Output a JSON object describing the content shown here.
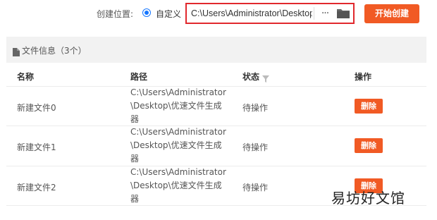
{
  "toolbar": {
    "create_location_label": "创建位置:",
    "radio_label": "自定义",
    "path_value": "C:\\Users\\Administrator\\Desktop",
    "more_label": "···",
    "start_button": "开始创建"
  },
  "panel": {
    "title": "文件信息（3个）",
    "columns": [
      "名称",
      "路径",
      "状态",
      "操作"
    ],
    "rows": [
      {
        "name": "新建文件0",
        "path_lines": [
          "C:\\Users\\Administrator",
          "\\Desktop\\优速文件生成",
          "器"
        ],
        "status": "待操作",
        "action": "删除"
      },
      {
        "name": "新建文件1",
        "path_lines": [
          "C:\\Users\\Administrator",
          "\\Desktop\\优速文件生成",
          "器"
        ],
        "status": "待操作",
        "action": "删除"
      },
      {
        "name": "新建文件2",
        "path_lines": [
          "C:\\Users\\Administrator",
          "\\Desktop\\优速文件生成",
          "器"
        ],
        "status": "待操作",
        "action": "删除"
      }
    ]
  },
  "watermark": "易坊好文馆",
  "colors": {
    "accent": "#f15a24",
    "highlight_border": "#e1282d",
    "radio": "#1677ff"
  }
}
